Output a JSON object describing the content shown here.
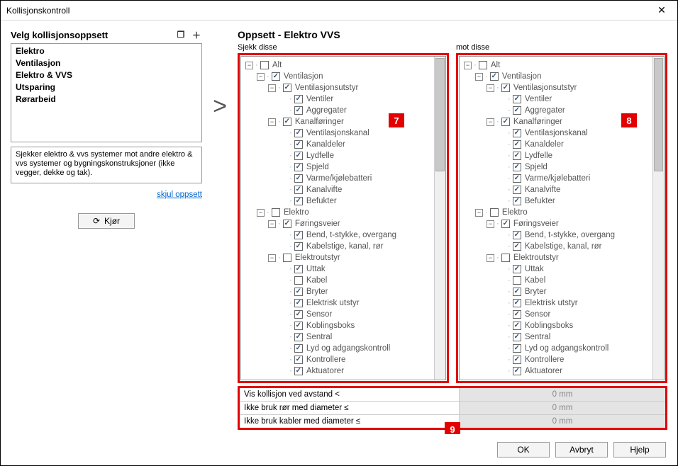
{
  "window": {
    "title": "Kollisjonskontroll"
  },
  "left": {
    "heading": "Velg kollisjonsoppsett",
    "copy_icon": "copy-icon",
    "add_icon": "plus-icon",
    "setups": [
      "Elektro",
      "Ventilasjon",
      "Elektro & VVS",
      "Utsparing",
      "Rørarbeid"
    ],
    "selected_index": 2,
    "description": "Sjekker elektro & vvs systemer mot andre elektro & vvs systemer og bygningskonstruksjoner (ikke vegger, dekke og tak).",
    "hide_link": "skjul oppsett",
    "run_label": "Kjør"
  },
  "arrow": ">",
  "right": {
    "title": "Oppsett - Elektro  VVS",
    "left_tree_label": "Sjekk disse",
    "right_tree_label": "mot disse",
    "badges": {
      "left": "7",
      "right": "8",
      "filters": "9"
    },
    "tree": {
      "root": {
        "label": "Alt",
        "checked": false,
        "expanded": true
      },
      "nodes": [
        {
          "label": "Ventilasjon",
          "checked": true,
          "expanded": true,
          "level": 1,
          "children": [
            {
              "label": "Ventilasjonsutstyr",
              "checked": true,
              "expanded": true,
              "level": 2,
              "children": [
                {
                  "label": "Ventiler",
                  "checked": true,
                  "level": 3
                },
                {
                  "label": "Aggregater",
                  "checked": true,
                  "level": 3
                }
              ]
            },
            {
              "label": "Kanalføringer",
              "checked": true,
              "expanded": true,
              "level": 2,
              "children": [
                {
                  "label": "Ventilasjonskanal",
                  "checked": true,
                  "level": 3
                },
                {
                  "label": "Kanaldeler",
                  "checked": true,
                  "level": 3
                },
                {
                  "label": "Lydfelle",
                  "checked": true,
                  "level": 3
                },
                {
                  "label": "Spjeld",
                  "checked": true,
                  "level": 3
                },
                {
                  "label": "Varme/kjølebatteri",
                  "checked": true,
                  "level": 3
                },
                {
                  "label": "Kanalvifte",
                  "checked": true,
                  "level": 3
                },
                {
                  "label": "Befukter",
                  "checked": true,
                  "level": 3
                }
              ]
            }
          ]
        },
        {
          "label": "Elektro",
          "checked": false,
          "expanded": true,
          "level": 1,
          "children": [
            {
              "label": "Føringsveier",
              "checked": true,
              "expanded": true,
              "level": 2,
              "children": [
                {
                  "label": "Bend, t-stykke, overgang",
                  "checked": true,
                  "level": 3
                },
                {
                  "label": "Kabelstige, kanal, rør",
                  "checked": true,
                  "level": 3
                }
              ]
            },
            {
              "label": "Elektroutstyr",
              "checked": false,
              "expanded": true,
              "level": 2,
              "children": [
                {
                  "label": "Uttak",
                  "checked": true,
                  "level": 3
                },
                {
                  "label": "Kabel",
                  "checked": false,
                  "level": 3
                },
                {
                  "label": "Bryter",
                  "checked": true,
                  "level": 3
                },
                {
                  "label": "Elektrisk utstyr",
                  "checked": true,
                  "level": 3
                },
                {
                  "label": "Sensor",
                  "checked": true,
                  "level": 3
                },
                {
                  "label": "Koblingsboks",
                  "checked": true,
                  "level": 3
                },
                {
                  "label": "Sentral",
                  "checked": true,
                  "level": 3
                },
                {
                  "label": "Lyd og adgangskontroll",
                  "checked": true,
                  "level": 3
                },
                {
                  "label": "Kontrollere",
                  "checked": true,
                  "level": 3
                },
                {
                  "label": "Aktuatorer",
                  "checked": true,
                  "level": 3
                }
              ]
            }
          ]
        }
      ]
    },
    "filters": [
      {
        "label": "Vis kollisjon ved avstand <",
        "value": "0 mm"
      },
      {
        "label": "Ikke bruk rør med diameter ≤",
        "value": "0 mm"
      },
      {
        "label": "Ikke bruk kabler med diameter ≤",
        "value": "0 mm"
      }
    ]
  },
  "footer": {
    "ok": "OK",
    "cancel": "Avbryt",
    "help": "Hjelp"
  }
}
